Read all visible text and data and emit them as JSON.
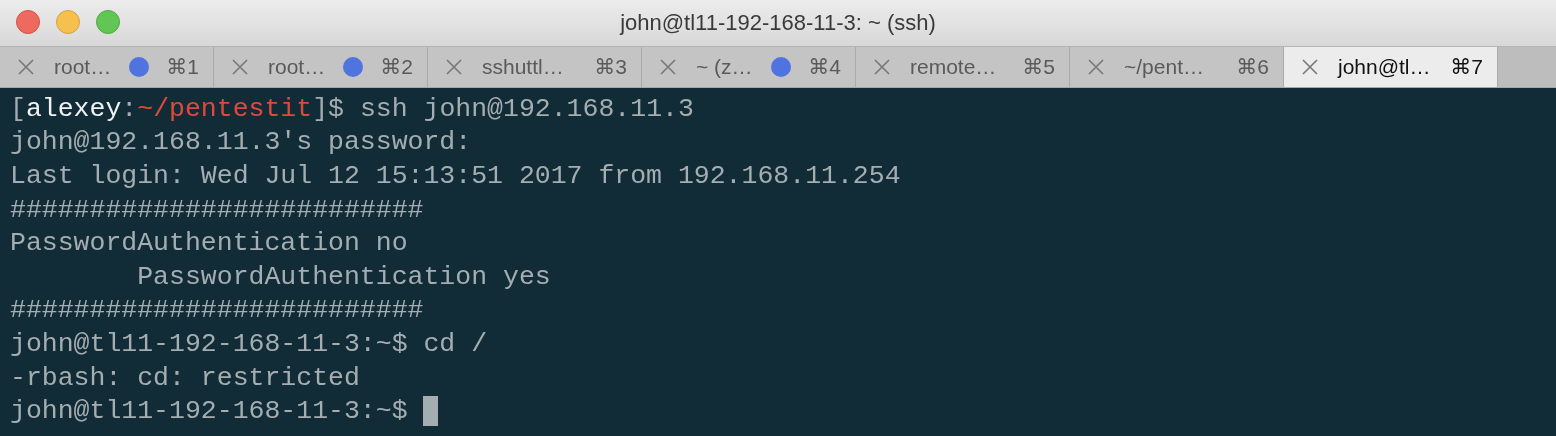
{
  "window": {
    "title": "john@tl11-192-168-11-3: ~ (ssh)"
  },
  "tabs": [
    {
      "label": "root…",
      "badge": true,
      "shortcut": "⌘1",
      "selected": false
    },
    {
      "label": "root…",
      "badge": true,
      "shortcut": "⌘2",
      "selected": false
    },
    {
      "label": "sshuttl…",
      "badge": false,
      "shortcut": "⌘3",
      "selected": false
    },
    {
      "label": "~ (z…",
      "badge": true,
      "shortcut": "⌘4",
      "selected": false
    },
    {
      "label": "remote…",
      "badge": false,
      "shortcut": "⌘5",
      "selected": false
    },
    {
      "label": "~/pent…",
      "badge": false,
      "shortcut": "⌘6",
      "selected": false
    },
    {
      "label": "john@tl…",
      "badge": false,
      "shortcut": "⌘7",
      "selected": true
    }
  ],
  "terminal": {
    "lines": [
      {
        "segments": [
          {
            "kind": "plain",
            "text": "["
          },
          {
            "kind": "user",
            "text": "alexey"
          },
          {
            "kind": "plain",
            "text": ":"
          },
          {
            "kind": "path",
            "text": "~/pentestit"
          },
          {
            "kind": "plain",
            "text": "]$ ssh john@192.168.11.3"
          }
        ],
        "cursor": false
      },
      {
        "segments": [
          {
            "kind": "plain",
            "text": "john@192.168.11.3's password:"
          }
        ],
        "cursor": false
      },
      {
        "segments": [
          {
            "kind": "plain",
            "text": "Last login: Wed Jul 12 15:13:51 2017 from 192.168.11.254"
          }
        ],
        "cursor": false
      },
      {
        "segments": [
          {
            "kind": "plain",
            "text": "##########################"
          }
        ],
        "cursor": false
      },
      {
        "segments": [
          {
            "kind": "plain",
            "text": "PasswordAuthentication no"
          }
        ],
        "cursor": false
      },
      {
        "segments": [
          {
            "kind": "plain",
            "text": "        PasswordAuthentication yes"
          }
        ],
        "cursor": false
      },
      {
        "segments": [
          {
            "kind": "plain",
            "text": "##########################"
          }
        ],
        "cursor": false
      },
      {
        "segments": [
          {
            "kind": "plain",
            "text": "john@tl11-192-168-11-3:~$ cd /"
          }
        ],
        "cursor": false
      },
      {
        "segments": [
          {
            "kind": "plain",
            "text": "-rbash: cd: restricted"
          }
        ],
        "cursor": false
      },
      {
        "segments": [
          {
            "kind": "plain",
            "text": "john@tl11-192-168-11-3:~$ "
          }
        ],
        "cursor": true
      }
    ]
  }
}
